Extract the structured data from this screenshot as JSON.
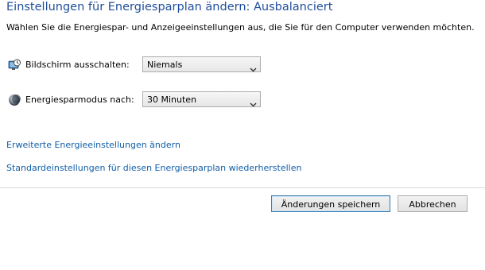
{
  "header": {
    "title": "Einstellungen für Energiesparplan ändern: Ausbalanciert",
    "description": "Wählen Sie die Energiespar- und Anzeigeeinstellungen aus, die Sie für den Computer verwenden möchten."
  },
  "settings": {
    "display_off": {
      "icon": "monitor-clock-icon",
      "label": "Bildschirm ausschalten:",
      "value": "Niemals"
    },
    "sleep": {
      "icon": "moon-icon",
      "label": "Energiesparmodus nach:",
      "value": "30 Minuten"
    }
  },
  "links": {
    "advanced": "Erweiterte Energieeinstellungen ändern",
    "restore_defaults": "Standardeinstellungen für diesen Energiesparplan wiederherstellen"
  },
  "buttons": {
    "save": "Änderungen speichern",
    "cancel": "Abbrechen"
  },
  "colors": {
    "title": "#1e4e9a",
    "link": "#0f5ea8"
  }
}
